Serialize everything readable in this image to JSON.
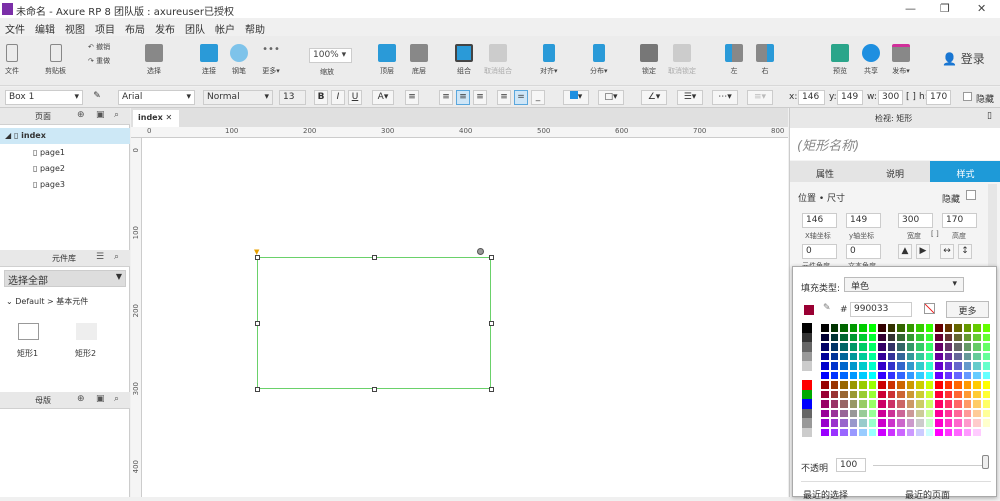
{
  "window": {
    "title": "未命名 - Axure RP 8 团队版 : axureuser已授权",
    "minimize": "—",
    "restore": "❐",
    "close": "✕"
  },
  "menu": [
    "文件",
    "编辑",
    "视图",
    "项目",
    "布局",
    "发布",
    "团队",
    "帐户",
    "帮助"
  ],
  "toolbar": {
    "file": "文件",
    "clipboard": "剪贴板",
    "undo": "撤销",
    "redo": "重做",
    "select": "选择",
    "connect": "连接",
    "pen": "钢笔",
    "more": "更多▾",
    "zoom_value": "100%",
    "zoom": "缩放",
    "top": "顶层",
    "bottom": "底层",
    "group": "组合",
    "ungroup": "取消组合",
    "align": "对齐▾",
    "distribute": "分布▾",
    "lock": "锁定",
    "unlock": "取消锁定",
    "left": "左",
    "right": "右",
    "preview": "预览",
    "share": "共享",
    "publish": "发布▾",
    "login": "登录"
  },
  "format": {
    "widget_name": "Box 1",
    "font": "Arial",
    "style": "Normal",
    "size": "13",
    "bold": "B",
    "italic": "I",
    "underline": "U",
    "x_label": "x:",
    "x": "146",
    "y_label": "y:",
    "y": "149",
    "w_label": "w:",
    "w": "300",
    "h_label": "h:",
    "h": "170",
    "hidden": "隐藏"
  },
  "pages": {
    "title": "页面",
    "items": [
      "index",
      "page1",
      "page2",
      "page3"
    ]
  },
  "library": {
    "title": "元件库",
    "select": "选择全部",
    "group": "Default > 基本元件",
    "items": [
      "矩形1",
      "矩形2"
    ]
  },
  "masters": {
    "title": "母版"
  },
  "canvas": {
    "tab": "index",
    "ruler_x": [
      "0",
      "100",
      "200",
      "300",
      "400",
      "500",
      "600",
      "700",
      "800"
    ],
    "ruler_y": [
      "0",
      "100",
      "200",
      "300",
      "400"
    ]
  },
  "inspector": {
    "title": "检视: 矩形",
    "name_placeholder": "(矩形名称)",
    "tabs": [
      "属性",
      "说明",
      "样式"
    ],
    "section": "位置 • 尺寸",
    "hidden": "隐藏",
    "x": "146",
    "y": "149",
    "w": "300",
    "h": "170",
    "x_label": "X轴坐标",
    "y_label": "y轴坐标",
    "w_label": "宽度",
    "h_label": "高度",
    "rot": "0",
    "text_rot": "0",
    "rot_label": "元件角度",
    "text_rot_label": "文本角度"
  },
  "fill": {
    "type_label": "填充类型:",
    "type": "单色",
    "hash": "#",
    "hex": "990033",
    "more": "更多",
    "opacity_label": "不透明",
    "opacity": "100",
    "recent": "最近的选择",
    "recent_page": "最近的页面",
    "current_color": "#990033"
  }
}
